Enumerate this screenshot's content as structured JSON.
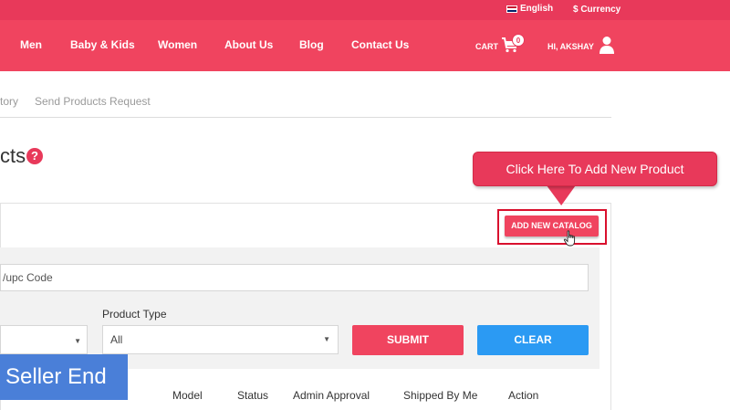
{
  "topbar": {
    "language": "English",
    "currency": "$ Currency"
  },
  "nav": {
    "items": [
      {
        "label": "Men"
      },
      {
        "label": "Baby & Kids"
      },
      {
        "label": "Women"
      },
      {
        "label": "About Us"
      },
      {
        "label": "Blog"
      },
      {
        "label": "Contact Us"
      }
    ],
    "cart_label": "CART",
    "cart_count": "0",
    "user_greeting": "HI, AKSHAY"
  },
  "subnav": {
    "items": [
      "tory",
      "Send Products Request"
    ]
  },
  "page": {
    "title": "cts",
    "help_icon": "?"
  },
  "callout": {
    "text": "Click Here To Add New Product"
  },
  "panel": {
    "add_catalog_label": "ADD NEW CATALOG",
    "search_value": "/upc Code",
    "product_type_label": "Product Type",
    "product_type_value": "All",
    "submit_label": "SUBMIT",
    "clear_label": "CLEAR"
  },
  "table": {
    "columns": [
      "Model",
      "Status",
      "Admin Approval",
      "Shipped By Me",
      "Action"
    ]
  },
  "overlay": {
    "seller_badge": "Seller End"
  },
  "colors": {
    "brand": "#f0445f",
    "brand_dark": "#e8395a",
    "clear_button": "#2b9af3",
    "badge": "#4a7fd8"
  }
}
